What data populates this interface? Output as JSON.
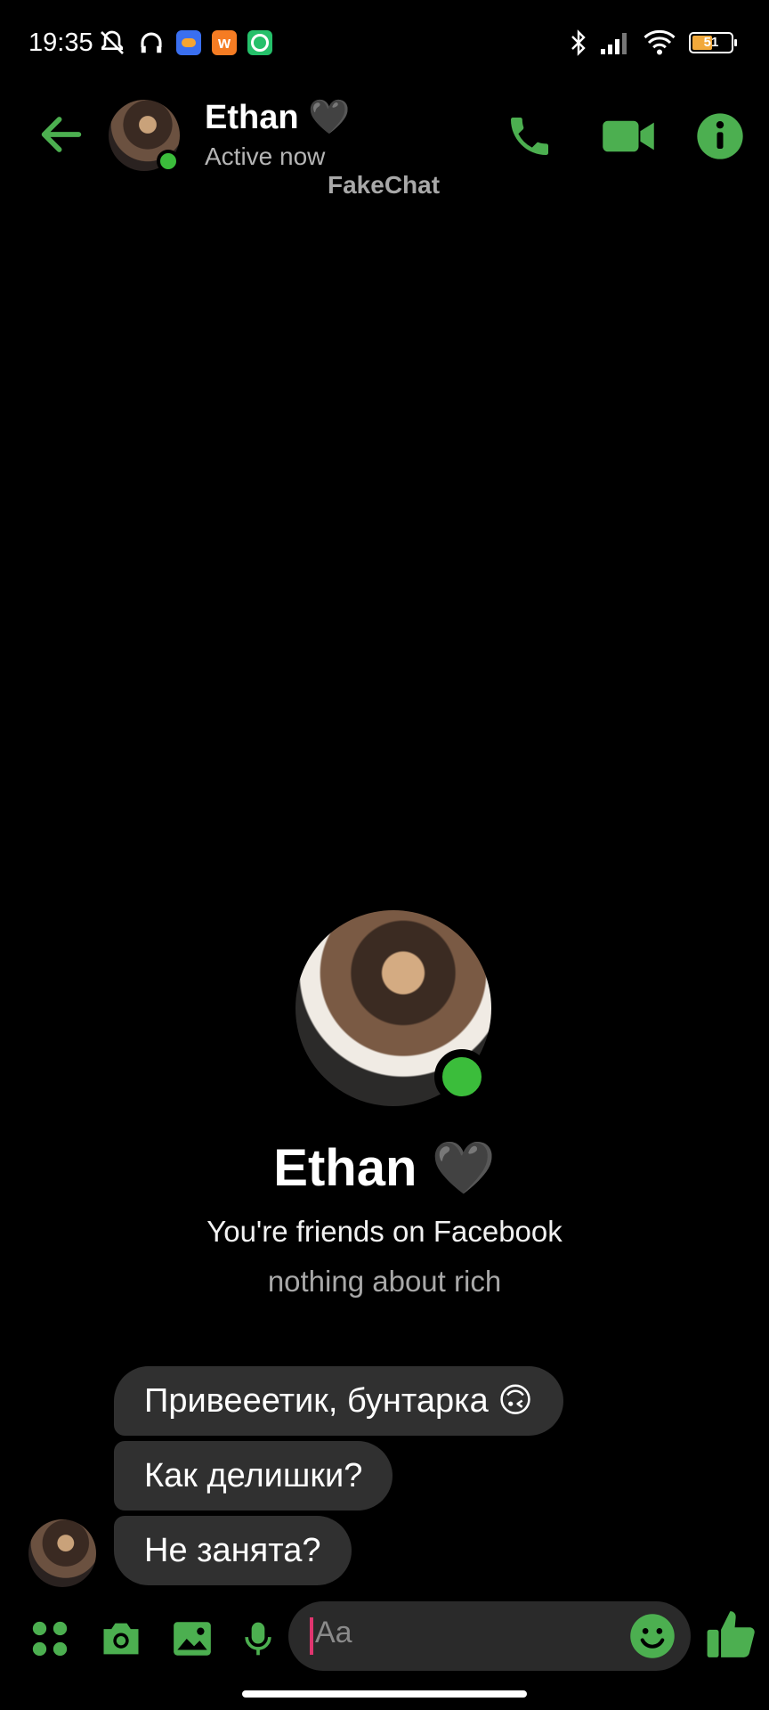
{
  "status_bar": {
    "time": "19:35",
    "battery": "51",
    "icons": [
      "mute-bell-icon",
      "headphones-icon",
      "cloud-app-icon",
      "w-app-icon",
      "check-app-icon",
      "bluetooth-icon",
      "signal-icon",
      "wifi-icon",
      "battery-icon"
    ]
  },
  "header": {
    "name": "Ethan 🖤",
    "status": "Active now",
    "watermark": "FakeChat",
    "accent": "#4caf50"
  },
  "profile": {
    "name": "Ethan 🖤",
    "subtitle": "You're friends on Facebook",
    "bio": "nothing about rich"
  },
  "messages": [
    {
      "text": "Привееетик, бунтарка 🙃"
    },
    {
      "text": "Как делишки?"
    },
    {
      "text": "Не занята?"
    }
  ],
  "composer": {
    "placeholder": "Aa"
  },
  "colors": {
    "accent": "#4caf50",
    "online": "#3bbd3b",
    "bubble": "#303030",
    "background": "#000000"
  }
}
